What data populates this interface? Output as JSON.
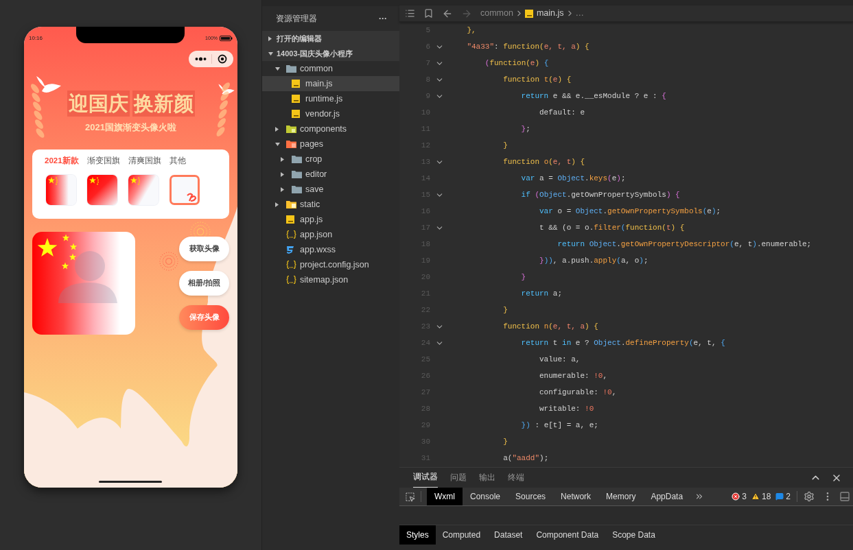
{
  "phone": {
    "status": {
      "time": "10:16",
      "battery": "100%"
    },
    "header": {
      "title_parts": [
        "迎国庆",
        "换新颜"
      ],
      "subtitle": "2021国旗渐变头像火啦"
    },
    "tabs": [
      {
        "label": "2021新款",
        "selected": true
      },
      {
        "label": "渐变国旗",
        "selected": false
      },
      {
        "label": "清爽国旗",
        "selected": false
      },
      {
        "label": "其他",
        "selected": false
      }
    ],
    "thumbnails": [
      {
        "kind": "fade"
      },
      {
        "kind": "diagonal"
      },
      {
        "kind": "soft"
      },
      {
        "kind": "frame"
      }
    ],
    "buttons": [
      {
        "label": "获取头像",
        "kind": "plain"
      },
      {
        "label": "相册/拍照",
        "kind": "plain"
      },
      {
        "label": "保存头像",
        "kind": "primary"
      }
    ]
  },
  "explorer": {
    "title": "资源管理器",
    "more": "···",
    "sections": [
      {
        "label": "打开的编辑器",
        "expanded": false
      },
      {
        "label": "14003-国庆头像小程序",
        "expanded": true
      }
    ],
    "tree": [
      {
        "label": "common",
        "kind": "folder",
        "expanded": true,
        "selected": false,
        "children": [
          {
            "label": "main.js",
            "kind": "js",
            "selected": true
          },
          {
            "label": "runtime.js",
            "kind": "js",
            "selected": false
          },
          {
            "label": "vendor.js",
            "kind": "js",
            "selected": false
          }
        ]
      },
      {
        "label": "components",
        "kind": "components",
        "expanded": false,
        "selected": false
      },
      {
        "label": "pages",
        "kind": "pages",
        "expanded": true,
        "selected": false,
        "children": [
          {
            "label": "crop",
            "kind": "folder",
            "expanded": false,
            "selected": false
          },
          {
            "label": "editor",
            "kind": "folder",
            "expanded": false,
            "selected": false
          },
          {
            "label": "save",
            "kind": "folder",
            "expanded": false,
            "selected": false
          }
        ]
      },
      {
        "label": "static",
        "kind": "static",
        "expanded": false,
        "selected": false
      },
      {
        "label": "app.js",
        "kind": "js",
        "selected": false
      },
      {
        "label": "app.json",
        "kind": "json",
        "selected": false
      },
      {
        "label": "app.wxss",
        "kind": "wxss",
        "selected": false
      },
      {
        "label": "project.config.json",
        "kind": "json",
        "selected": false
      },
      {
        "label": "sitemap.json",
        "kind": "json",
        "selected": false
      }
    ]
  },
  "editor": {
    "breadcrumb": [
      "common",
      "main.js",
      "…"
    ],
    "lines": [
      {
        "n": "5",
        "fold": false,
        "tokens": [
          {
            "text": "    },",
            "kind": "b1"
          }
        ]
      },
      {
        "n": "6",
        "fold": true,
        "tokens": [
          {
            "text": "    \"4a33\"",
            "kind": "str"
          },
          {
            "text": ": ",
            "kind": "plain"
          },
          {
            "text": "function",
            "kind": "fn"
          },
          {
            "text": "(",
            "kind": "b1"
          },
          {
            "text": "e, t, a",
            "kind": "param"
          },
          {
            "text": ") {",
            "kind": "b1"
          }
        ]
      },
      {
        "n": "7",
        "fold": true,
        "tokens": [
          {
            "text": "        (",
            "kind": "b2"
          },
          {
            "text": "function",
            "kind": "fn"
          },
          {
            "text": "(",
            "kind": "b1"
          },
          {
            "text": "e",
            "kind": "param"
          },
          {
            "text": ")",
            "kind": "b1"
          },
          {
            "text": " {",
            "kind": "b3"
          }
        ]
      },
      {
        "n": "8",
        "fold": true,
        "tokens": [
          {
            "text": "            function",
            "kind": "fn"
          },
          {
            "text": " t",
            "kind": "method"
          },
          {
            "text": "(",
            "kind": "b1"
          },
          {
            "text": "e",
            "kind": "param"
          },
          {
            "text": ") {",
            "kind": "b1"
          }
        ]
      },
      {
        "n": "9",
        "fold": true,
        "tokens": [
          {
            "text": "                return",
            "kind": "kw"
          },
          {
            "text": " e && e.__esModule ? e : ",
            "kind": "plain"
          },
          {
            "text": "{",
            "kind": "b2"
          }
        ]
      },
      {
        "n": "10",
        "fold": false,
        "tokens": [
          {
            "text": "                    default: e",
            "kind": "plain"
          }
        ]
      },
      {
        "n": "11",
        "fold": false,
        "tokens": [
          {
            "text": "                }",
            "kind": "b2"
          },
          {
            "text": ";",
            "kind": "plain"
          }
        ]
      },
      {
        "n": "12",
        "fold": false,
        "tokens": [
          {
            "text": "            }",
            "kind": "b1"
          }
        ]
      },
      {
        "n": "13",
        "fold": true,
        "tokens": [
          {
            "text": "            function",
            "kind": "fn"
          },
          {
            "text": " o",
            "kind": "method"
          },
          {
            "text": "(",
            "kind": "b1"
          },
          {
            "text": "e, t",
            "kind": "param"
          },
          {
            "text": ") {",
            "kind": "b1"
          }
        ]
      },
      {
        "n": "14",
        "fold": false,
        "tokens": [
          {
            "text": "                var",
            "kind": "kw"
          },
          {
            "text": " a = ",
            "kind": "plain"
          },
          {
            "text": "Object",
            "kind": "obj"
          },
          {
            "text": ".",
            "kind": "plain"
          },
          {
            "text": "keys",
            "kind": "method"
          },
          {
            "text": "(",
            "kind": "b2"
          },
          {
            "text": "e",
            "kind": "plain"
          },
          {
            "text": ")",
            "kind": "b2"
          },
          {
            "text": ";",
            "kind": "plain"
          }
        ]
      },
      {
        "n": "15",
        "fold": true,
        "tokens": [
          {
            "text": "                if",
            "kind": "kw"
          },
          {
            "text": " (",
            "kind": "b2"
          },
          {
            "text": "Object",
            "kind": "obj"
          },
          {
            "text": ".getOwnPropertySymbols",
            "kind": "plain"
          },
          {
            "text": ") {",
            "kind": "b2"
          }
        ]
      },
      {
        "n": "16",
        "fold": false,
        "tokens": [
          {
            "text": "                    var",
            "kind": "kw"
          },
          {
            "text": " o = ",
            "kind": "plain"
          },
          {
            "text": "Object",
            "kind": "obj"
          },
          {
            "text": ".",
            "kind": "plain"
          },
          {
            "text": "getOwnPropertySymbols",
            "kind": "method"
          },
          {
            "text": "(",
            "kind": "b3"
          },
          {
            "text": "e",
            "kind": "plain"
          },
          {
            "text": ")",
            "kind": "b3"
          },
          {
            "text": ";",
            "kind": "plain"
          }
        ]
      },
      {
        "n": "17",
        "fold": true,
        "tokens": [
          {
            "text": "                    t && (o = o.",
            "kind": "plain"
          },
          {
            "text": "filter",
            "kind": "method"
          },
          {
            "text": "(",
            "kind": "b3"
          },
          {
            "text": "function",
            "kind": "fn"
          },
          {
            "text": "(",
            "kind": "b1"
          },
          {
            "text": "t",
            "kind": "param"
          },
          {
            "text": ") {",
            "kind": "b1"
          }
        ]
      },
      {
        "n": "18",
        "fold": false,
        "tokens": [
          {
            "text": "                        return ",
            "kind": "kw"
          },
          {
            "text": "Object",
            "kind": "obj"
          },
          {
            "text": ".",
            "kind": "plain"
          },
          {
            "text": "getOwnPropertyDescriptor",
            "kind": "method"
          },
          {
            "text": "(",
            "kind": "b3"
          },
          {
            "text": "e, t",
            "kind": "plain"
          },
          {
            "text": ")",
            "kind": "b3"
          },
          {
            "text": ".enumerable;",
            "kind": "plain"
          }
        ]
      },
      {
        "n": "19",
        "fold": false,
        "tokens": [
          {
            "text": "                    }",
            "kind": "b2"
          },
          {
            "text": "))",
            "kind": "b3"
          },
          {
            "text": ", a.push.",
            "kind": "plain"
          },
          {
            "text": "apply",
            "kind": "method"
          },
          {
            "text": "(",
            "kind": "b3"
          },
          {
            "text": "a, o",
            "kind": "plain"
          },
          {
            "text": ")",
            "kind": "b3"
          },
          {
            "text": ";",
            "kind": "plain"
          }
        ]
      },
      {
        "n": "20",
        "fold": false,
        "tokens": [
          {
            "text": "                }",
            "kind": "b2"
          }
        ]
      },
      {
        "n": "21",
        "fold": false,
        "tokens": [
          {
            "text": "                return",
            "kind": "kw"
          },
          {
            "text": " a;",
            "kind": "plain"
          }
        ]
      },
      {
        "n": "22",
        "fold": false,
        "tokens": [
          {
            "text": "            }",
            "kind": "b1"
          }
        ]
      },
      {
        "n": "23",
        "fold": true,
        "tokens": [
          {
            "text": "            function",
            "kind": "fn"
          },
          {
            "text": " n",
            "kind": "method"
          },
          {
            "text": "(",
            "kind": "b1"
          },
          {
            "text": "e, t, a",
            "kind": "param"
          },
          {
            "text": ") {",
            "kind": "b1"
          }
        ]
      },
      {
        "n": "24",
        "fold": true,
        "tokens": [
          {
            "text": "                return",
            "kind": "kw"
          },
          {
            "text": " t ",
            "kind": "plain"
          },
          {
            "text": "in",
            "kind": "kw"
          },
          {
            "text": " e ? ",
            "kind": "plain"
          },
          {
            "text": "Object",
            "kind": "obj"
          },
          {
            "text": ".",
            "kind": "plain"
          },
          {
            "text": "defineProperty",
            "kind": "method"
          },
          {
            "text": "(",
            "kind": "b3"
          },
          {
            "text": "e, t, ",
            "kind": "plain"
          },
          {
            "text": "{",
            "kind": "b3"
          }
        ]
      },
      {
        "n": "25",
        "fold": false,
        "tokens": [
          {
            "text": "                    value: a,",
            "kind": "plain"
          }
        ]
      },
      {
        "n": "26",
        "fold": false,
        "tokens": [
          {
            "text": "                    enumerable: ",
            "kind": "plain"
          },
          {
            "text": "!0",
            "kind": "num"
          },
          {
            "text": ",",
            "kind": "plain"
          }
        ]
      },
      {
        "n": "27",
        "fold": false,
        "tokens": [
          {
            "text": "                    configurable: ",
            "kind": "plain"
          },
          {
            "text": "!0",
            "kind": "num"
          },
          {
            "text": ",",
            "kind": "plain"
          }
        ]
      },
      {
        "n": "28",
        "fold": false,
        "tokens": [
          {
            "text": "                    writable: ",
            "kind": "plain"
          },
          {
            "text": "!0",
            "kind": "num"
          }
        ]
      },
      {
        "n": "29",
        "fold": false,
        "tokens": [
          {
            "text": "                })",
            "kind": "b3"
          },
          {
            "text": " : e[t] = a, e;",
            "kind": "plain"
          }
        ]
      },
      {
        "n": "30",
        "fold": false,
        "tokens": [
          {
            "text": "            }",
            "kind": "b1"
          }
        ]
      },
      {
        "n": "31",
        "fold": false,
        "tokens": [
          {
            "text": "            a(",
            "kind": "plain"
          },
          {
            "text": "\"aadd\"",
            "kind": "str"
          },
          {
            "text": ");",
            "kind": "plain"
          }
        ]
      }
    ]
  },
  "panel": {
    "tabs": [
      {
        "label": "调试器",
        "selected": true
      },
      {
        "label": "问题",
        "selected": false
      },
      {
        "label": "输出",
        "selected": false
      },
      {
        "label": "终端",
        "selected": false
      }
    ],
    "devtools_tabs": [
      {
        "label": "Wxml",
        "selected": true
      },
      {
        "label": "Console",
        "selected": false
      },
      {
        "label": "Sources",
        "selected": false
      },
      {
        "label": "Network",
        "selected": false
      },
      {
        "label": "Memory",
        "selected": false
      },
      {
        "label": "AppData",
        "selected": false
      }
    ],
    "errors": "3",
    "warnings": "18",
    "messages": "2",
    "style_tabs": [
      {
        "label": "Styles",
        "selected": true
      },
      {
        "label": "Computed",
        "selected": false
      },
      {
        "label": "Dataset",
        "selected": false
      },
      {
        "label": "Component Data",
        "selected": false
      },
      {
        "label": "Scope Data",
        "selected": false
      }
    ]
  }
}
